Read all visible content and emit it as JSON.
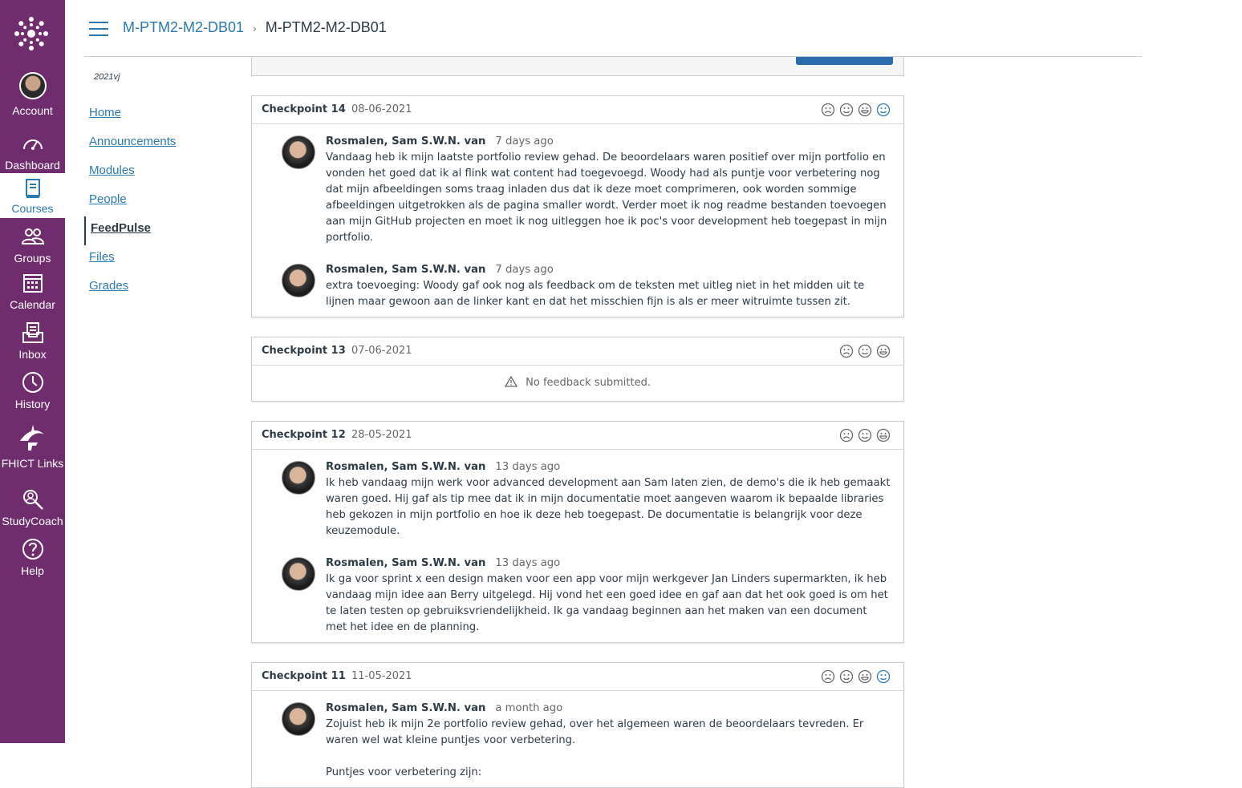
{
  "global_nav": {
    "items": [
      {
        "label": "Account",
        "icon": "user-avatar-icon"
      },
      {
        "label": "Dashboard",
        "icon": "dashboard-gauge-icon"
      },
      {
        "label": "Courses",
        "icon": "book-icon",
        "active": true
      },
      {
        "label": "Groups",
        "icon": "groups-icon"
      },
      {
        "label": "Calendar",
        "icon": "calendar-icon"
      },
      {
        "label": "Inbox",
        "icon": "inbox-icon"
      },
      {
        "label": "History",
        "icon": "clock-icon"
      },
      {
        "label": "FHICT Links",
        "icon": "fhict-logo-icon"
      },
      {
        "label": "StudyCoach",
        "icon": "studycoach-icon"
      },
      {
        "label": "Help",
        "icon": "help-icon"
      }
    ],
    "bg_color": "#6f2d6e"
  },
  "header": {
    "crumb_course": "M-PTM2-M2-DB01",
    "crumb_current": "M-PTM2-M2-DB01"
  },
  "course_nav": {
    "term": "2021vj",
    "items": [
      "Home",
      "Announcements",
      "Modules",
      "People",
      "FeedPulse",
      "Files",
      "Grades"
    ],
    "active": "FeedPulse"
  },
  "checkpoints": [
    {
      "title": "Checkpoint 14",
      "date": "08-06-2021",
      "entries": [
        {
          "author": "Rosmalen, Sam S.W.N. van",
          "ago": "7 days ago",
          "text": "Vandaag heb ik mijn laatste portfolio review gehad. De beoordelaars waren positief over mijn portfolio en vonden het goed dat ik al flink wat content had toegevoegd. Woody had als puntje voor verbetering nog dat mijn afbeeldingen soms traag inladen dus dat ik deze moet comprimeren, ook worden sommige afbeeldingen uitgetrokken als de pagina smaller wordt. Verder moet ik nog readme bestanden toevoegen aan mijn GitHub projecten en moet ik nog uitleggen hoe ik poc's voor development heb toegepast in mijn portfolio."
        },
        {
          "author": "Rosmalen, Sam S.W.N. van",
          "ago": "7 days ago",
          "text": "extra toevoeging: Woody gaf ook nog als feedback om de teksten met uitleg niet in het midden uit te lijnen maar gewoon aan de linker kant en dat het misschien fijn is als er meer witruimte tussen zit."
        }
      ]
    },
    {
      "title": "Checkpoint 13",
      "date": "07-06-2021",
      "entries": [],
      "empty_text": "No feedback submitted."
    },
    {
      "title": "Checkpoint 12",
      "date": "28-05-2021",
      "entries": [
        {
          "author": "Rosmalen, Sam S.W.N. van",
          "ago": "13 days ago",
          "text": "Ik heb vandaag mijn werk voor advanced development aan Sam laten zien, de demo's die ik heb gemaakt waren goed. Hij gaf als tip mee dat ik in mijn documentatie moet aangeven waarom ik bepaalde libraries heb gekozen in mijn portfolio en hoe ik deze heb toegepast. De documentatie is belangrijk voor deze keuzemodule."
        },
        {
          "author": "Rosmalen, Sam S.W.N. van",
          "ago": "13 days ago",
          "text": "Ik ga voor sprint x een design maken voor een app voor mijn werkgever Jan Linders supermarkten, ik heb vandaag mijn idee aan Berry uitgelegd. Hij vond het een goed idee en gaf aan dat het ook goed is om het te laten testen op gebruiksvriendelijkheid. Ik ga vandaag beginnen aan het maken van een document met het idee en de planning."
        }
      ]
    },
    {
      "title": "Checkpoint 11",
      "date": "11-05-2021",
      "entries": [
        {
          "author": "Rosmalen, Sam S.W.N. van",
          "ago": "a month ago",
          "text": "Zojuist heb ik mijn 2e portfolio review gehad, over het algemeen waren de beoordelaars tevreden. Er waren wel wat kleine puntjes voor verbetering.\n\nPuntjes voor verbetering zijn:"
        }
      ]
    }
  ],
  "colors": {
    "link": "#2a7ab0",
    "accent_face": "#2a7ab0"
  }
}
